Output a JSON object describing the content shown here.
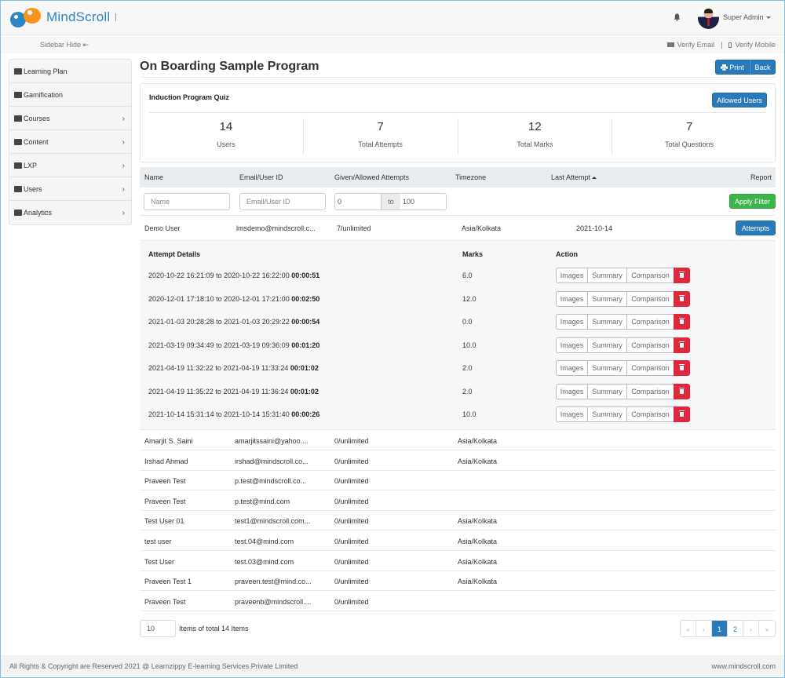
{
  "header": {
    "brand": "MindScroll",
    "user_name": "Super Admin",
    "icons": {
      "bell": "bell-icon",
      "avatar": "user-avatar",
      "caret": "caret-down-icon"
    }
  },
  "subbar": {
    "sidebar_hide": "Sidebar Hide",
    "sidebar_hide_icon": "⇤",
    "verify_email": "Verify Email",
    "separator": "|",
    "verify_mobile": "Verify Mobile"
  },
  "sidebar": {
    "items": [
      {
        "label": "Learning Plan",
        "icon": "book-open-icon",
        "has_submenu": false
      },
      {
        "label": "Gamification",
        "icon": "trophy-icon",
        "has_submenu": false
      },
      {
        "label": "Courses",
        "icon": "list-alt-icon",
        "has_submenu": true
      },
      {
        "label": "Content",
        "icon": "file-icon",
        "has_submenu": true
      },
      {
        "label": "LXP",
        "icon": "book-open-icon",
        "has_submenu": true
      },
      {
        "label": "Users",
        "icon": "users-icon",
        "has_submenu": true
      },
      {
        "label": "Analytics",
        "icon": "line-chart-icon",
        "has_submenu": true
      }
    ],
    "chevron": "›"
  },
  "page": {
    "title": "On Boarding Sample Program",
    "print_label": "Print",
    "back_label": "Back"
  },
  "quiz": {
    "title": "Induction Program Quiz",
    "allowed_users_label": "Allowed Users",
    "stats": [
      {
        "value": "14",
        "label": "Users"
      },
      {
        "value": "7",
        "label": "Total Attempts"
      },
      {
        "value": "12",
        "label": "Total Marks"
      },
      {
        "value": "7",
        "label": "Total Questions"
      }
    ]
  },
  "table": {
    "columns": [
      "Name",
      "Email/User ID",
      "Given/Allowed Attempts",
      "Timezone",
      "Last Attempt",
      "Report"
    ],
    "filters": {
      "name_placeholder": "Name",
      "email_placeholder": "Email/User ID",
      "attempts_from": "0",
      "range_sep": "to",
      "attempts_to": "100",
      "apply_label": "Apply Filter"
    },
    "expanded_row": {
      "name": "Demo User",
      "email": "lmsdemo@mindscroll.c...",
      "attempts": "7/unlimited",
      "timezone": "Asia/Kolkata",
      "last_attempt": "2021-10-14",
      "report_label": "Attempts"
    },
    "attempt_details": {
      "headers": {
        "details": "Attempt Details",
        "marks": "Marks",
        "action": "Action"
      },
      "actions": {
        "images": "Images",
        "summary": "Summary",
        "comparison": "Comparison"
      },
      "rows": [
        {
          "start": "2020-10-22 16:21:09",
          "sep": "to",
          "end": "2020-10-22 16:22:00",
          "duration": "00:00:51",
          "marks": "6.0"
        },
        {
          "start": "2020-12-01 17:18:10",
          "sep": "to",
          "end": "2020-12-01 17:21:00",
          "duration": "00:02:50",
          "marks": "12.0"
        },
        {
          "start": "2021-01-03 20:28:28",
          "sep": "to",
          "end": "2021-01-03 20:29:22",
          "duration": "00:00:54",
          "marks": "0.0"
        },
        {
          "start": "2021-03-19 09:34:49",
          "sep": "to",
          "end": "2021-03-19 09:36:09",
          "duration": "00:01:20",
          "marks": "10.0"
        },
        {
          "start": "2021-04-19 11:32:22",
          "sep": "to",
          "end": "2021-04-19 11:33:24",
          "duration": "00:01:02",
          "marks": "2.0"
        },
        {
          "start": "2021-04-19 11:35:22",
          "sep": "to",
          "end": "2021-04-19 11:36:24",
          "duration": "00:01:02",
          "marks": "2.0"
        },
        {
          "start": "2021-10-14 15:31:14",
          "sep": "to",
          "end": "2021-10-14 15:31:40",
          "duration": "00:00:26",
          "marks": "10.0"
        }
      ]
    },
    "rows": [
      {
        "name": "Amarjit S. Saini",
        "email": "amarjitssaini@yahoo....",
        "attempts": "0/unlimited",
        "timezone": "Asia/Kolkata"
      },
      {
        "name": "Irshad Ahmad",
        "email": "irshad@mindscroll.co...",
        "attempts": "0/unlimited",
        "timezone": "Asia/Kolkata"
      },
      {
        "name": "Praveen Test",
        "email": "p.test@mindscroll.co...",
        "attempts": "0/unlimited",
        "timezone": ""
      },
      {
        "name": "Praveen Test",
        "email": "p.test@mind.com",
        "attempts": "0/unlimited",
        "timezone": ""
      },
      {
        "name": "Test User 01",
        "email": "test1@mindscroll.com...",
        "attempts": "0/unlimited",
        "timezone": "Asia/Kolkata"
      },
      {
        "name": "test user",
        "email": "test.04@mind.com",
        "attempts": "0/unlimited",
        "timezone": "Asia/Kolkata"
      },
      {
        "name": "Test User",
        "email": "test.03@mind.com",
        "attempts": "0/unlimited",
        "timezone": "Asia/Kolkata"
      },
      {
        "name": "Praveen Test 1",
        "email": "praveen.test@mind.co...",
        "attempts": "0/unlimited",
        "timezone": "Asia/Kolkata"
      },
      {
        "name": "Praveen Test",
        "email": "praveenb@mindscroll....",
        "attempts": "0/unlimited",
        "timezone": ""
      }
    ]
  },
  "pagination": {
    "per_page": "10",
    "summary": "Items of total 14 Items",
    "first": "«",
    "prev": "‹",
    "pages": [
      "1",
      "2"
    ],
    "current_page": "1",
    "next": "›",
    "last": "»"
  },
  "footer": {
    "copyright": "All Rights & Copyright are Reserved 2021 @ Learnzippy E-learning Services Private Limited",
    "website": "www.mindscroll.com"
  },
  "colors": {
    "primary": "#2a7ab9",
    "success": "#3db44a",
    "danger": "#e0283c",
    "brand_blue": "#2b86c5",
    "brand_orange": "#f7941d"
  }
}
